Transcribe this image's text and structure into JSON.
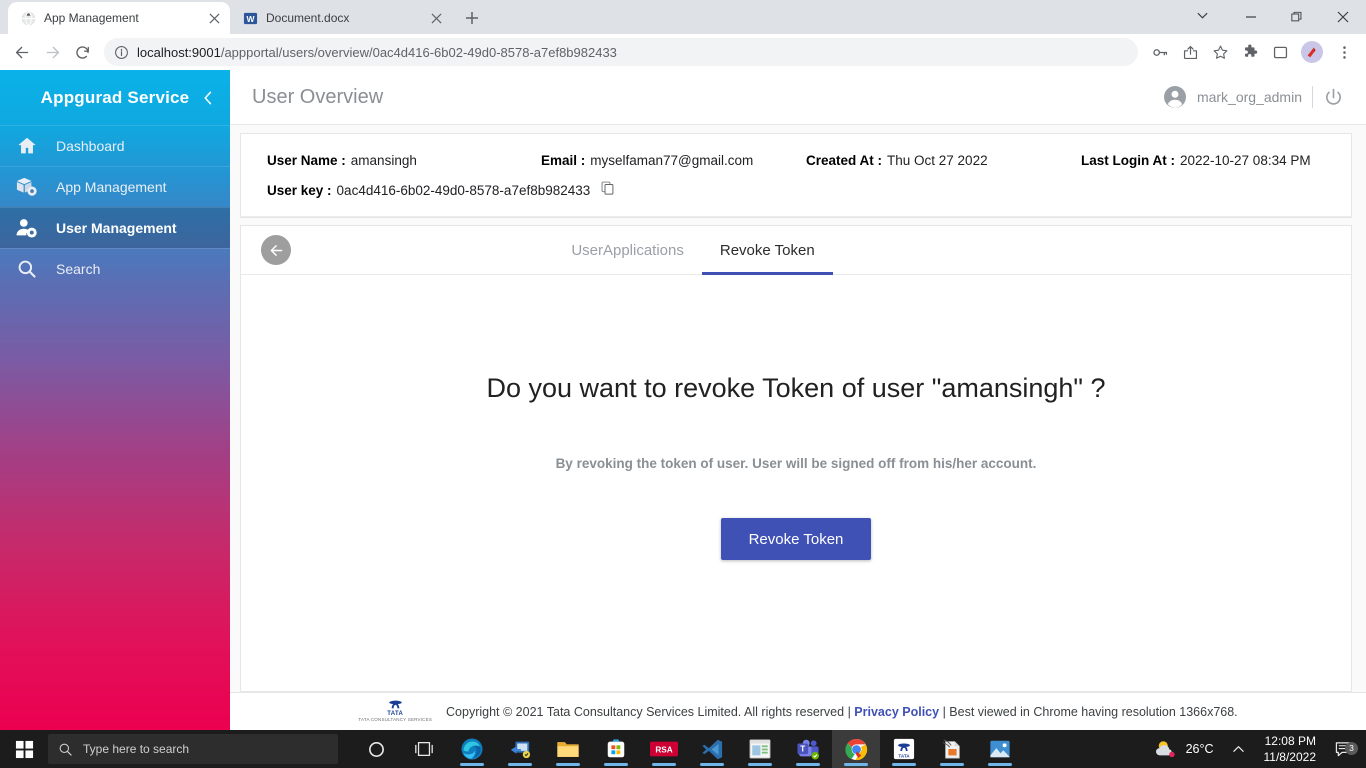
{
  "browser": {
    "tabs": [
      {
        "title": "App Management",
        "favicon": "globe-icon",
        "active": true
      },
      {
        "title": "Document.docx",
        "favicon": "word-icon",
        "active": false
      }
    ],
    "new_tab_label": "+",
    "window_controls": {
      "tab_search": "tab-search-icon",
      "minimize": "minimize-icon",
      "maximize": "maximize-icon",
      "close": "close-icon"
    },
    "toolbar": {
      "back": "back-arrow-icon",
      "forward": "forward-arrow-icon",
      "reload": "reload-icon",
      "site_info": "info-circle-icon",
      "url_host": "localhost:9001",
      "url_path": "/appportal/users/overview/0ac4d416-6b02-49d0-8578-a7ef8b982433",
      "url_full": "localhost:9001/appportal/users/overview/0ac4d416-6b02-49d0-8578-a7ef8b982433",
      "icons": [
        "key-icon",
        "share-icon",
        "bookmark-star-icon",
        "extensions-puzzle-icon",
        "side-panel-icon",
        "profile-avatar-icon",
        "three-dot-menu-icon"
      ]
    }
  },
  "sidebar": {
    "brand": "Appgurad Service",
    "collapse_icon": "chevron-left-icon",
    "items": [
      {
        "label": "Dashboard",
        "icon": "home-icon",
        "active": false
      },
      {
        "label": "App Management",
        "icon": "app-box-gear-icon",
        "active": false
      },
      {
        "label": "User Management",
        "icon": "user-gear-icon",
        "active": true
      },
      {
        "label": "Search",
        "icon": "search-icon",
        "active": false
      }
    ]
  },
  "header": {
    "title": "User Overview",
    "account_icon": "account-circle-icon",
    "user": "mark_org_admin",
    "power_icon": "power-icon"
  },
  "user_info": {
    "user_name_label": "User Name :",
    "user_name_value": "amansingh",
    "email_label": "Email :",
    "email_value": "myselfaman77@gmail.com",
    "created_label": "Created At :",
    "created_value": "Thu Oct 27 2022",
    "last_login_label": "Last Login At :",
    "last_login_value": "2022-10-27 08:34 PM",
    "user_key_label": "User key :",
    "user_key_value": "0ac4d416-6b02-49d0-8578-a7ef8b982433",
    "copy_icon": "copy-icon"
  },
  "card": {
    "back_icon": "back-arrow-circle-icon",
    "tabs": [
      {
        "label": "UserApplications",
        "active": false
      },
      {
        "label": "Revoke Token",
        "active": true
      }
    ],
    "revoke": {
      "question": "Do you want to revoke Token of user \"amansingh\" ?",
      "subtext": "By revoking the token of user. User will be signed off from his/her account.",
      "button_label": "Revoke Token",
      "button_color": "#3f51b5"
    }
  },
  "footer": {
    "logo_word": "TATA",
    "logo_sub": "TATA CONSULTANCY SERVICES",
    "copyright": "Copyright © 2021 Tata Consultancy Services Limited. All rights reserved |",
    "privacy_link": "Privacy Policy",
    "tail": "| Best viewed in Chrome having resolution 1366x768."
  },
  "taskbar": {
    "start_icon": "windows-start-icon",
    "search_icon": "search-icon",
    "search_placeholder": "Type here to search",
    "apps": [
      {
        "name": "cortana-icon"
      },
      {
        "name": "task-view-icon"
      },
      {
        "name": "edge-icon"
      },
      {
        "name": "remote-desktop-icon"
      },
      {
        "name": "file-explorer-icon"
      },
      {
        "name": "microsoft-store-icon"
      },
      {
        "name": "rsa-icon"
      },
      {
        "name": "vscode-icon"
      },
      {
        "name": "window-app-icon"
      },
      {
        "name": "microsoft-teams-icon"
      },
      {
        "name": "chrome-icon"
      },
      {
        "name": "tata-app-icon"
      },
      {
        "name": "office-file-icon"
      },
      {
        "name": "photos-icon"
      }
    ],
    "tray": {
      "weather_icon": "partly-cloudy-icon",
      "temperature": "26°C",
      "chevron": "chevron-up-icon",
      "time": "12:08 PM",
      "date": "11/8/2022",
      "notification_icon": "notification-icon",
      "notification_count": "3"
    }
  }
}
